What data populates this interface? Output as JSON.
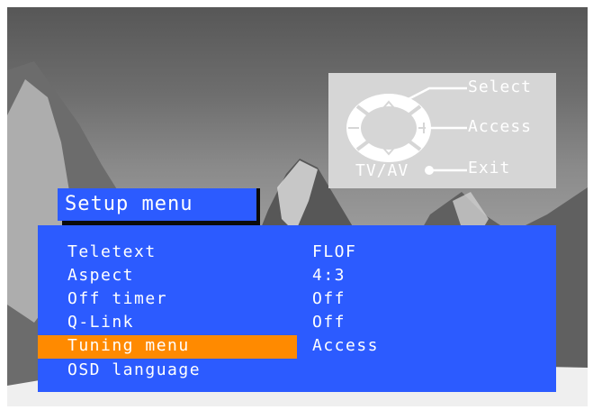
{
  "remote_legend": {
    "select_label": "Select",
    "access_label": "Access",
    "exit_label": "Exit",
    "tvav_label": "TV/AV"
  },
  "setup_menu": {
    "title": "Setup menu",
    "items": [
      {
        "label": "Teletext",
        "value": "FLOF",
        "selected": false
      },
      {
        "label": "Aspect",
        "value": "4:3",
        "selected": false
      },
      {
        "label": "Off timer",
        "value": "Off",
        "selected": false
      },
      {
        "label": "Q-Link",
        "value": "Off",
        "selected": false
      },
      {
        "label": "Tuning menu",
        "value": "Access",
        "selected": true
      },
      {
        "label": "OSD language",
        "value": "",
        "selected": false
      }
    ]
  },
  "colors": {
    "menu_blue": "#2c5bff",
    "highlight_orange": "#ff8a00",
    "legend_grey": "#d6d6d6"
  }
}
